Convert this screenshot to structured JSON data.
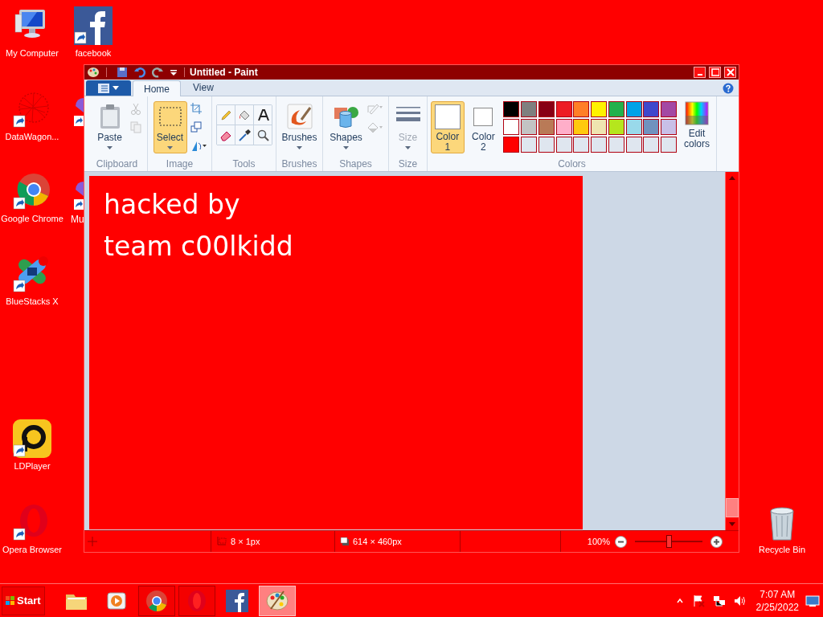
{
  "desktop_icons": [
    {
      "label": "My Computer",
      "kind": "computer",
      "shortcut": false
    },
    {
      "label": "facebook",
      "kind": "facebook",
      "shortcut": true
    },
    {
      "label": "DataWagon...",
      "kind": "web",
      "shortcut": true
    },
    {
      "label": "Google Chrome",
      "kind": "chrome",
      "shortcut": true
    },
    {
      "label": "BlueStacks X",
      "kind": "bluestacks",
      "shortcut": true
    },
    {
      "label": "LDPlayer",
      "kind": "ldplayer",
      "shortcut": true
    },
    {
      "label": "Opera Browser",
      "kind": "opera",
      "shortcut": true
    },
    {
      "label": "Recycle Bin",
      "kind": "recycle",
      "shortcut": false
    }
  ],
  "covered_icons": [
    {
      "shortcut": true
    },
    {
      "label": "Mu",
      "shortcut": true
    }
  ],
  "window": {
    "title": "Untitled - Paint",
    "tabs": [
      {
        "label": "Home",
        "selected": true
      },
      {
        "label": "View",
        "selected": false
      }
    ],
    "groups": [
      {
        "label": "Clipboard",
        "buttons": [
          {
            "kind": "paste",
            "label": "Paste",
            "selected": false,
            "disabled": false
          }
        ],
        "small": [
          {
            "kind": "cut",
            "disabled": true
          },
          {
            "kind": "copy",
            "disabled": true
          }
        ]
      },
      {
        "label": "Image",
        "buttons": [
          {
            "kind": "select",
            "label": "Select",
            "selected": true,
            "disabled": false
          }
        ],
        "small": [
          {
            "kind": "crop",
            "disabled": false
          },
          {
            "kind": "resize",
            "disabled": false
          },
          {
            "kind": "rotate",
            "disabled": false
          }
        ]
      },
      {
        "label": "Tools",
        "grid": [
          {
            "kind": "pencil"
          },
          {
            "kind": "fill"
          },
          {
            "kind": "text"
          },
          {
            "kind": "eraser"
          },
          {
            "kind": "picker"
          },
          {
            "kind": "magnifier"
          }
        ]
      },
      {
        "label": "Brushes",
        "buttons": [
          {
            "kind": "brush",
            "label": "Brushes",
            "selected": false,
            "disabled": false
          }
        ]
      },
      {
        "label": "Shapes",
        "buttons": [
          {
            "kind": "shapes",
            "label": "Shapes",
            "selected": false,
            "disabled": false
          }
        ],
        "small": [
          {
            "kind": "outline",
            "disabled": true
          },
          {
            "kind": "shape-fill",
            "disabled": true
          }
        ]
      },
      {
        "label": "Size",
        "buttons": [
          {
            "kind": "size",
            "label": "Size",
            "selected": false,
            "disabled": true
          }
        ]
      },
      {
        "label": "Colors",
        "colors": [
          {
            "label": "Color 1",
            "color": "#ffffff",
            "selected": true
          },
          {
            "label": "Color 2",
            "color": "#ffffff",
            "selected": false
          }
        ],
        "palette": [
          {
            "kind": "color",
            "color": "#000000"
          },
          {
            "kind": "color",
            "color": "#7f7f7f"
          },
          {
            "kind": "color",
            "color": "#880015"
          },
          {
            "kind": "color",
            "color": "#ed1c24"
          },
          {
            "kind": "color",
            "color": "#ff7f27"
          },
          {
            "kind": "color",
            "color": "#fff200"
          },
          {
            "kind": "color",
            "color": "#22b14c"
          },
          {
            "kind": "color",
            "color": "#00a2e8"
          },
          {
            "kind": "color",
            "color": "#3f48cc"
          },
          {
            "kind": "color",
            "color": "#a349a4"
          },
          {
            "kind": "color",
            "color": "#ffffff"
          },
          {
            "kind": "color",
            "color": "#c3c3c3"
          },
          {
            "kind": "color",
            "color": "#b97a57"
          },
          {
            "kind": "color",
            "color": "#ffaec9"
          },
          {
            "kind": "color",
            "color": "#ffc90e"
          },
          {
            "kind": "color",
            "color": "#efe4b0"
          },
          {
            "kind": "color",
            "color": "#b5e61d"
          },
          {
            "kind": "color",
            "color": "#99d9ea"
          },
          {
            "kind": "color",
            "color": "#7092be"
          },
          {
            "kind": "color",
            "color": "#c8bfe7"
          },
          {
            "kind": "color",
            "color": "#ff0000"
          },
          {
            "kind": "empty"
          },
          {
            "kind": "empty"
          },
          {
            "kind": "empty"
          },
          {
            "kind": "empty"
          },
          {
            "kind": "empty"
          },
          {
            "kind": "empty"
          },
          {
            "kind": "empty"
          },
          {
            "kind": "empty"
          },
          {
            "kind": "empty"
          }
        ],
        "edit": "Edit colors"
      }
    ],
    "canvas": {
      "lines": [
        "hacked by",
        "team c00lkidd"
      ]
    },
    "status_bar": {
      "selection_size": "8 × 1px",
      "canvas_size": "614 × 460px",
      "zoom": "100%",
      "zoom_slider": {
        "level": 0.5
      }
    }
  },
  "taskbar": {
    "start": "Start",
    "apps": [
      {
        "kind": "folder",
        "running": false,
        "active": false
      },
      {
        "kind": "media",
        "running": false,
        "active": false
      },
      {
        "kind": "chrome",
        "running": true,
        "active": false
      },
      {
        "kind": "opera",
        "running": true,
        "active": false
      },
      {
        "kind": "facebook",
        "running": false,
        "active": false
      },
      {
        "kind": "paint",
        "running": true,
        "active": true
      }
    ],
    "time": "7:07 AM",
    "date": "2/25/2022"
  }
}
